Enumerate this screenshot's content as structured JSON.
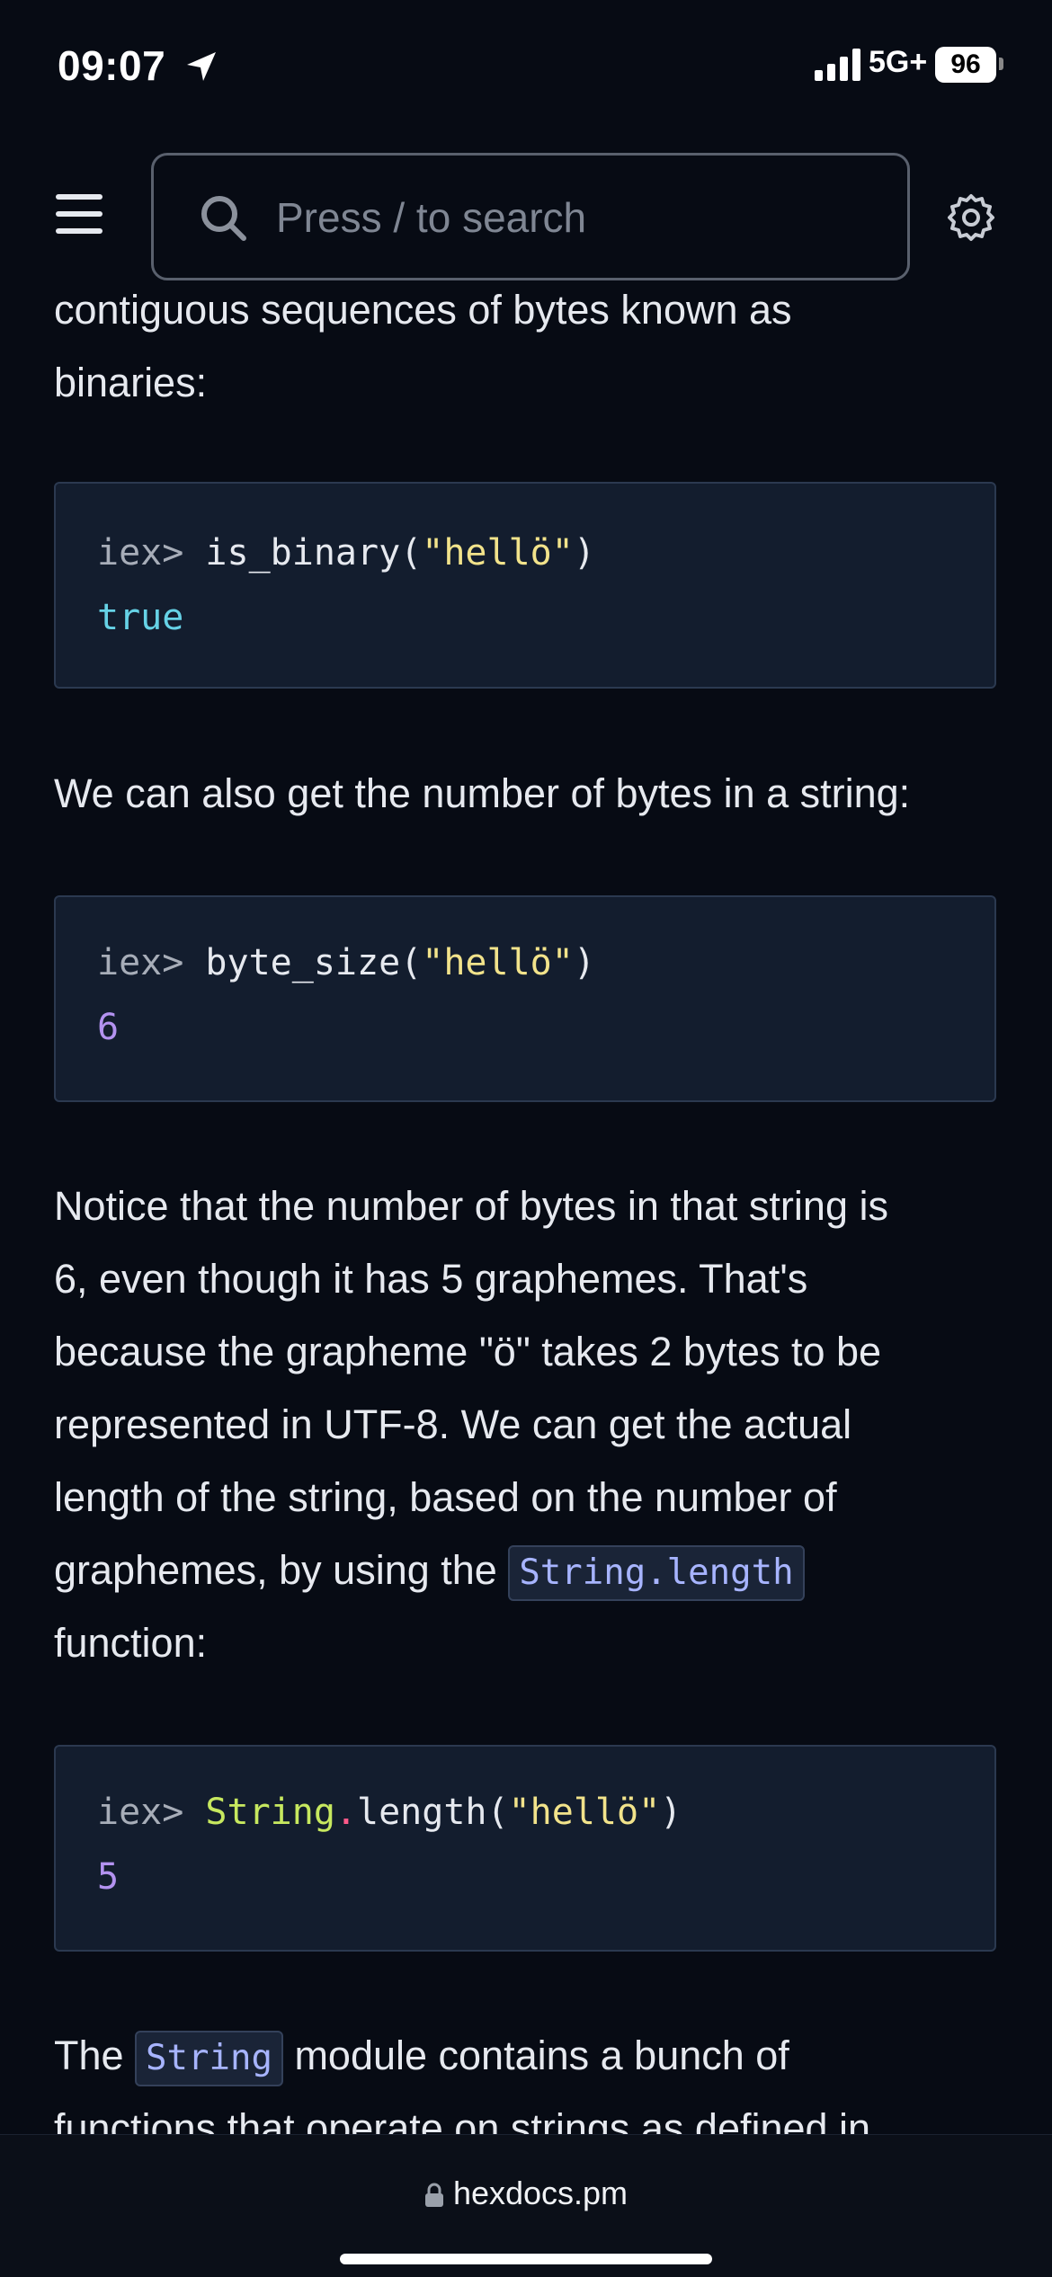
{
  "status_bar": {
    "time": "09:07",
    "network": "5G+",
    "battery": "96"
  },
  "header": {
    "search_placeholder": "Press / to search"
  },
  "content": {
    "intro_lines": [
      "contiguous sequences of bytes known as",
      "binaries:"
    ],
    "code1": {
      "prompt": "iex> ",
      "fn": "is_binary(",
      "string": "\"hellö\"",
      "close": ")",
      "result": "true"
    },
    "para_bytes": "We can also get the number of bytes in a string:",
    "code2": {
      "prompt": "iex> ",
      "fn": "byte_size(",
      "string": "\"hellö\"",
      "close": ")",
      "result": "6"
    },
    "notice_lines": [
      "Notice that the number of bytes in that string is",
      "6, even though it has 5 graphemes. That's",
      "because the grapheme \"ö\" takes 2 bytes to be",
      "represented in UTF-8. We can get the actual",
      "length of the string, based on the number of"
    ],
    "notice_line6_prefix": "graphemes, by using the ",
    "notice_inline_code": "String.length",
    "notice_last": "function:",
    "code3": {
      "prompt": "iex> ",
      "module": "String",
      "dot": ".",
      "fn": "length(",
      "string": "\"hellö\"",
      "close": ")",
      "result": "5"
    },
    "module_prefix": "The ",
    "module_inline_code": "String",
    "module_suffix": " module contains a bunch of",
    "module_line2": "functions that operate on strings as defined in"
  },
  "bottom_bar": {
    "url": "hexdocs.pm"
  }
}
